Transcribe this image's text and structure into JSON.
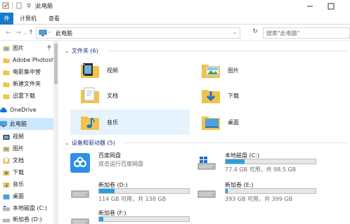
{
  "window": {
    "title": "此电脑",
    "controls": [
      "minimize",
      "maximize"
    ]
  },
  "ribbon": {
    "tabs": [
      {
        "label": "件",
        "active": true
      },
      {
        "label": "计算机",
        "active": false
      },
      {
        "label": "查看",
        "active": false
      }
    ]
  },
  "address": {
    "path": "此电脑",
    "search_placeholder": "搜索\"此电脑\""
  },
  "sidebar": {
    "items": [
      {
        "label": "图片",
        "icon": "pictures-folder-icon",
        "pinned": true
      },
      {
        "label": "Adobe Photosh",
        "icon": "folder-icon",
        "pinned": false
      },
      {
        "label": "电影集中营",
        "icon": "folder-icon",
        "pinned": false
      },
      {
        "label": "新建文件夹",
        "icon": "folder-icon",
        "pinned": false
      },
      {
        "label": "迅雷下载",
        "icon": "folder-icon",
        "pinned": false
      },
      {
        "label": "OneDrive",
        "icon": "onedrive-cloud-icon",
        "pinned": false
      },
      {
        "label": "此电脑",
        "icon": "computer-icon",
        "pinned": false,
        "selected": true
      },
      {
        "label": "视频",
        "icon": "videos-folder-icon",
        "pinned": false
      },
      {
        "label": "图片",
        "icon": "pictures-folder-icon",
        "pinned": false
      },
      {
        "label": "文档",
        "icon": "documents-folder-icon",
        "pinned": false
      },
      {
        "label": "下载",
        "icon": "downloads-folder-icon",
        "pinned": false
      },
      {
        "label": "音乐",
        "icon": "music-folder-icon",
        "pinned": false
      },
      {
        "label": "桌面",
        "icon": "desktop-folder-icon",
        "pinned": false
      },
      {
        "label": "本地磁盘 (C:)",
        "icon": "system-drive-icon",
        "pinned": false
      },
      {
        "label": "新加卷 (D:)",
        "icon": "drive-icon",
        "pinned": false
      }
    ]
  },
  "folders_group": {
    "header": "文件夹 (6)",
    "items": [
      {
        "label": "视频",
        "icon": "videos-folder-icon"
      },
      {
        "label": "图片",
        "icon": "pictures-folder-icon"
      },
      {
        "label": "文档",
        "icon": "documents-folder-icon"
      },
      {
        "label": "下载",
        "icon": "downloads-folder-icon"
      },
      {
        "label": "音乐",
        "icon": "music-folder-icon",
        "selected": true
      },
      {
        "label": "桌面",
        "icon": "desktop-folder-icon"
      }
    ]
  },
  "devices_group": {
    "header": "设备和驱动器 (5)",
    "items": [
      {
        "name": "百度网盘",
        "sub": "双击运行百度网盘",
        "icon": "baidu-netdisk-icon"
      },
      {
        "name": "本地磁盘 (C:)",
        "info": "77.4 GB 可用，共 98.5 GB",
        "used_fraction": 0.21,
        "icon": "system-drive-icon"
      },
      {
        "name": "新加卷 (D:)",
        "info": "114 GB 可用，共 138 GB",
        "used_fraction": 0.17,
        "icon": "drive-icon"
      },
      {
        "name": "新加卷 (E:)",
        "info": "393 GB 可用，共 399 GB",
        "used_fraction": 0.02,
        "icon": "drive-icon"
      },
      {
        "name": "新加卷 (F:)",
        "info": "",
        "used_fraction": 0.05,
        "icon": "drive-icon"
      }
    ]
  },
  "colors": {
    "accent": "#1979ca",
    "selection": "#cce8ff",
    "hover": "#e5f3ff",
    "drive_bar": "#26a0da",
    "folder": "#f0c24e"
  }
}
